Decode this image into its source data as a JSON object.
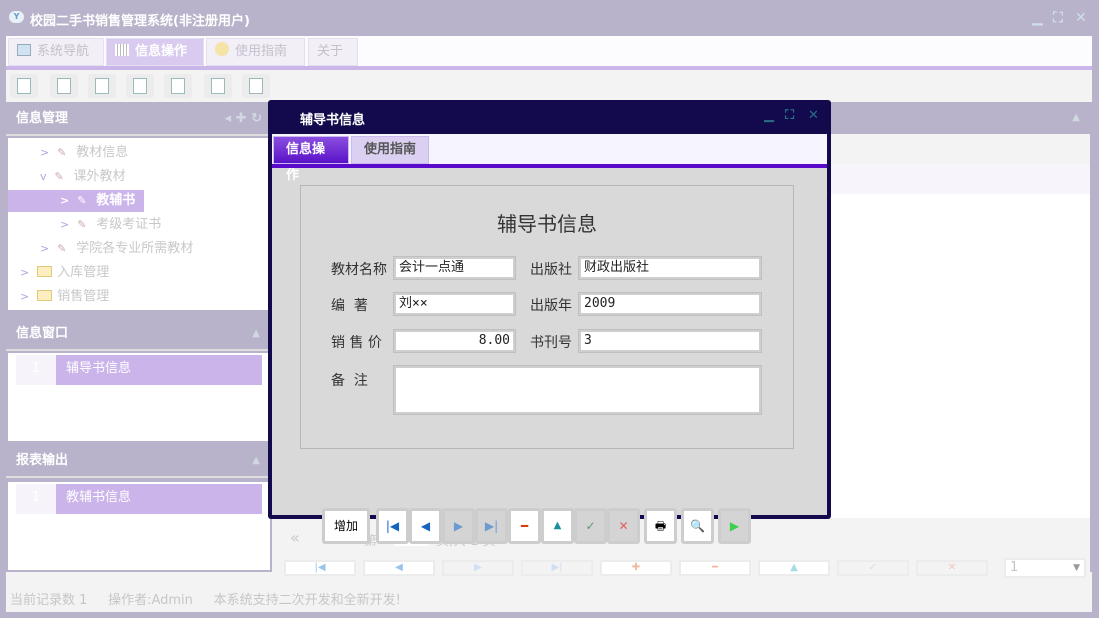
{
  "app": {
    "title": "校园二手书销售管理系统(非注册用户)",
    "logo_text": "Y"
  },
  "tabs": [
    {
      "label": "系统导航",
      "icon": "monitor-icon"
    },
    {
      "label": "信息操作",
      "icon": "grid-icon"
    },
    {
      "label": "使用指南",
      "icon": "help-icon"
    },
    {
      "label": "关于"
    }
  ],
  "left": {
    "info_mgmt": "信息管理",
    "tree": [
      {
        "label": "教材信息"
      },
      {
        "label": "课外教材"
      },
      {
        "label": "教辅书"
      },
      {
        "label": "考级考证书"
      },
      {
        "label": "学院各专业所需教材"
      },
      {
        "label": "入库管理"
      },
      {
        "label": "销售管理"
      }
    ],
    "info_window": "信息窗口",
    "window_rows": [
      {
        "num": "1",
        "label": "辅导书信息"
      }
    ],
    "report": "报表输出",
    "report_rows": [
      {
        "num": "1",
        "label": "教辅书信息"
      }
    ]
  },
  "pager": {
    "prefix": "第",
    "page": "1",
    "suffix": "页,共 1 页",
    "page_size": "1"
  },
  "status": {
    "records": "当前记录数 1",
    "operator": "操作者:Admin",
    "note": "本系统支持二次开发和全新开发!"
  },
  "dialog": {
    "title": "辅导书信息",
    "tabs": [
      "信息操作",
      "使用指南"
    ],
    "form_title": "辅导书信息",
    "fields": {
      "name_label": "教材名称",
      "name": "会计一点通",
      "publisher_label": "出版社",
      "publisher": "财政出版社",
      "author_label": "编  著",
      "author": "刘××",
      "year_label": "出版年",
      "year": "2009",
      "price_label": "销 售 价",
      "price": "8.00",
      "issue_label": "书刊号",
      "issue": "3",
      "remark_label": "备  注",
      "remark": ""
    },
    "add_label": "增加"
  },
  "colors": {
    "accent": "#5a0acb",
    "frame": "#b8b3ca",
    "dialog": "#120a4c",
    "selected": "#cbb4ea"
  }
}
